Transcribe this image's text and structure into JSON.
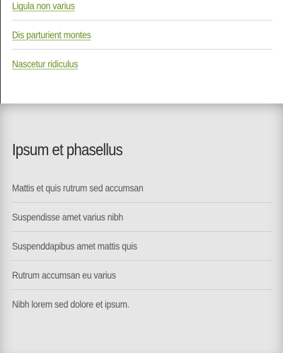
{
  "top_section": {
    "links": [
      "Ligula non varius",
      "Dis parturient montes",
      "Nascetur ridiculus"
    ]
  },
  "bottom_section": {
    "heading": "Ipsum et phasellus",
    "items": [
      "Mattis et quis rutrum sed accumsan",
      "Suspendisse amet varius nibh",
      "Suspenddapibus amet mattis quis",
      "Rutrum accumsan eu varius",
      "Nibh lorem sed dolore et ipsum."
    ]
  },
  "colors": {
    "link": "#6b8e23",
    "bottom_background": "#e6e6e6",
    "body_text": "#555555",
    "heading_text": "#2b2b2b"
  }
}
